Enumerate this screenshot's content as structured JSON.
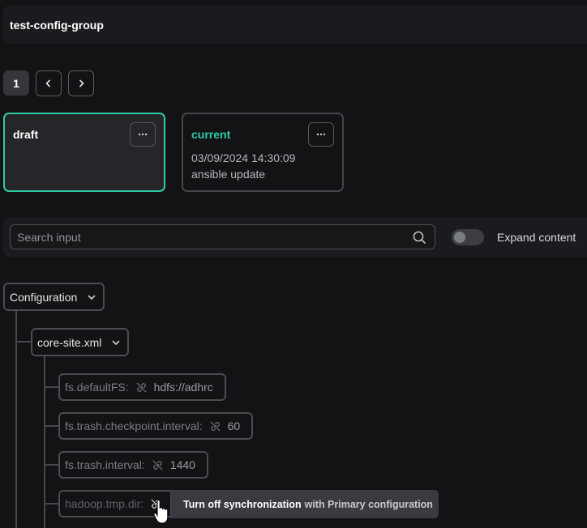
{
  "header": {
    "title": "test-config-group"
  },
  "pagination": {
    "current_page": "1"
  },
  "versions": [
    {
      "name": "draft",
      "selected": true
    },
    {
      "name": "current",
      "date": "03/09/2024 14:30:09",
      "description": "ansible update",
      "selected": false
    }
  ],
  "search": {
    "placeholder": "Search input",
    "value": ""
  },
  "expand_toggle": {
    "label": "Expand content",
    "on": false
  },
  "tree": {
    "root": {
      "label": "Configuration"
    },
    "file": {
      "label": "core-site.xml"
    },
    "fields": [
      {
        "key": "fs.defaultFS:",
        "value": "hdfs://adhrc"
      },
      {
        "key": "fs.trash.checkpoint.interval:",
        "value": "60"
      },
      {
        "key": "fs.trash.interval:",
        "value": "1440"
      },
      {
        "key": "hadoop.tmp.dir:",
        "value": ""
      }
    ]
  },
  "tooltip": {
    "bold": "Turn off synchronization",
    "rest": "with Primary configuration"
  },
  "colors": {
    "accent": "#2fcba6",
    "background": "#131316",
    "panel": "#1b1b1f"
  },
  "icons": [
    "chevron-left-icon",
    "chevron-right-icon",
    "more-icon",
    "search-icon",
    "chevron-down-icon",
    "sync-off-icon",
    "hand-cursor-icon"
  ]
}
